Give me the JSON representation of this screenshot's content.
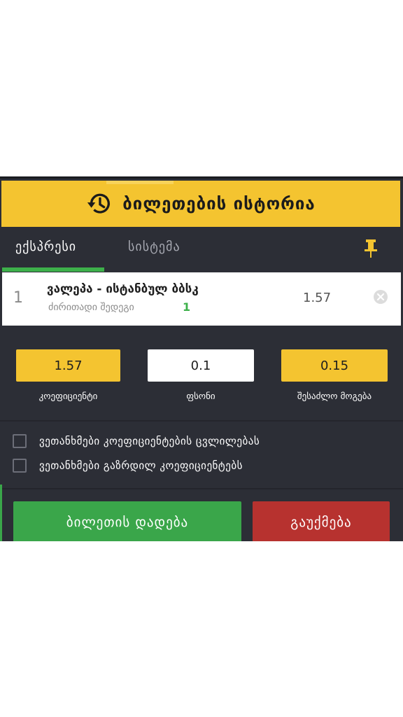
{
  "header": {
    "title": "ბილეთების ისტორია",
    "icon": "history-icon",
    "bg_color": "#f4c430"
  },
  "tabs": [
    {
      "label": "ექსპრესი",
      "active": true
    },
    {
      "label": "სისტემა",
      "active": false
    }
  ],
  "pin": {
    "icon": "pin-icon",
    "color": "#f4c430"
  },
  "bet": {
    "index": "1",
    "match": "ვალეპა - ისტანბულ ბბსკ",
    "market": "ძირითადი შედეგი",
    "pick": "1",
    "odd": "1.57"
  },
  "fields": {
    "odds_value": "1.57",
    "odds_label": "კოეფიციენტი",
    "stake_value": "0.1",
    "stake_label": "ფსონი",
    "win_value": "0.15",
    "win_label": "შესაძლო მოგება"
  },
  "options": [
    {
      "label": "ვეთანხმები კოეფიციენტების ცვლილებას",
      "checked": false
    },
    {
      "label": "ვეთანხმები გაზრდილ კოეფიციენტებს",
      "checked": false
    }
  ],
  "actions": {
    "place_label": "ბილეთის დადება",
    "cancel_label": "გაუქმება"
  },
  "colors": {
    "accent": "#f4c430",
    "green": "#3aa64a",
    "red": "#b7322f",
    "panel": "#2c2e36"
  }
}
